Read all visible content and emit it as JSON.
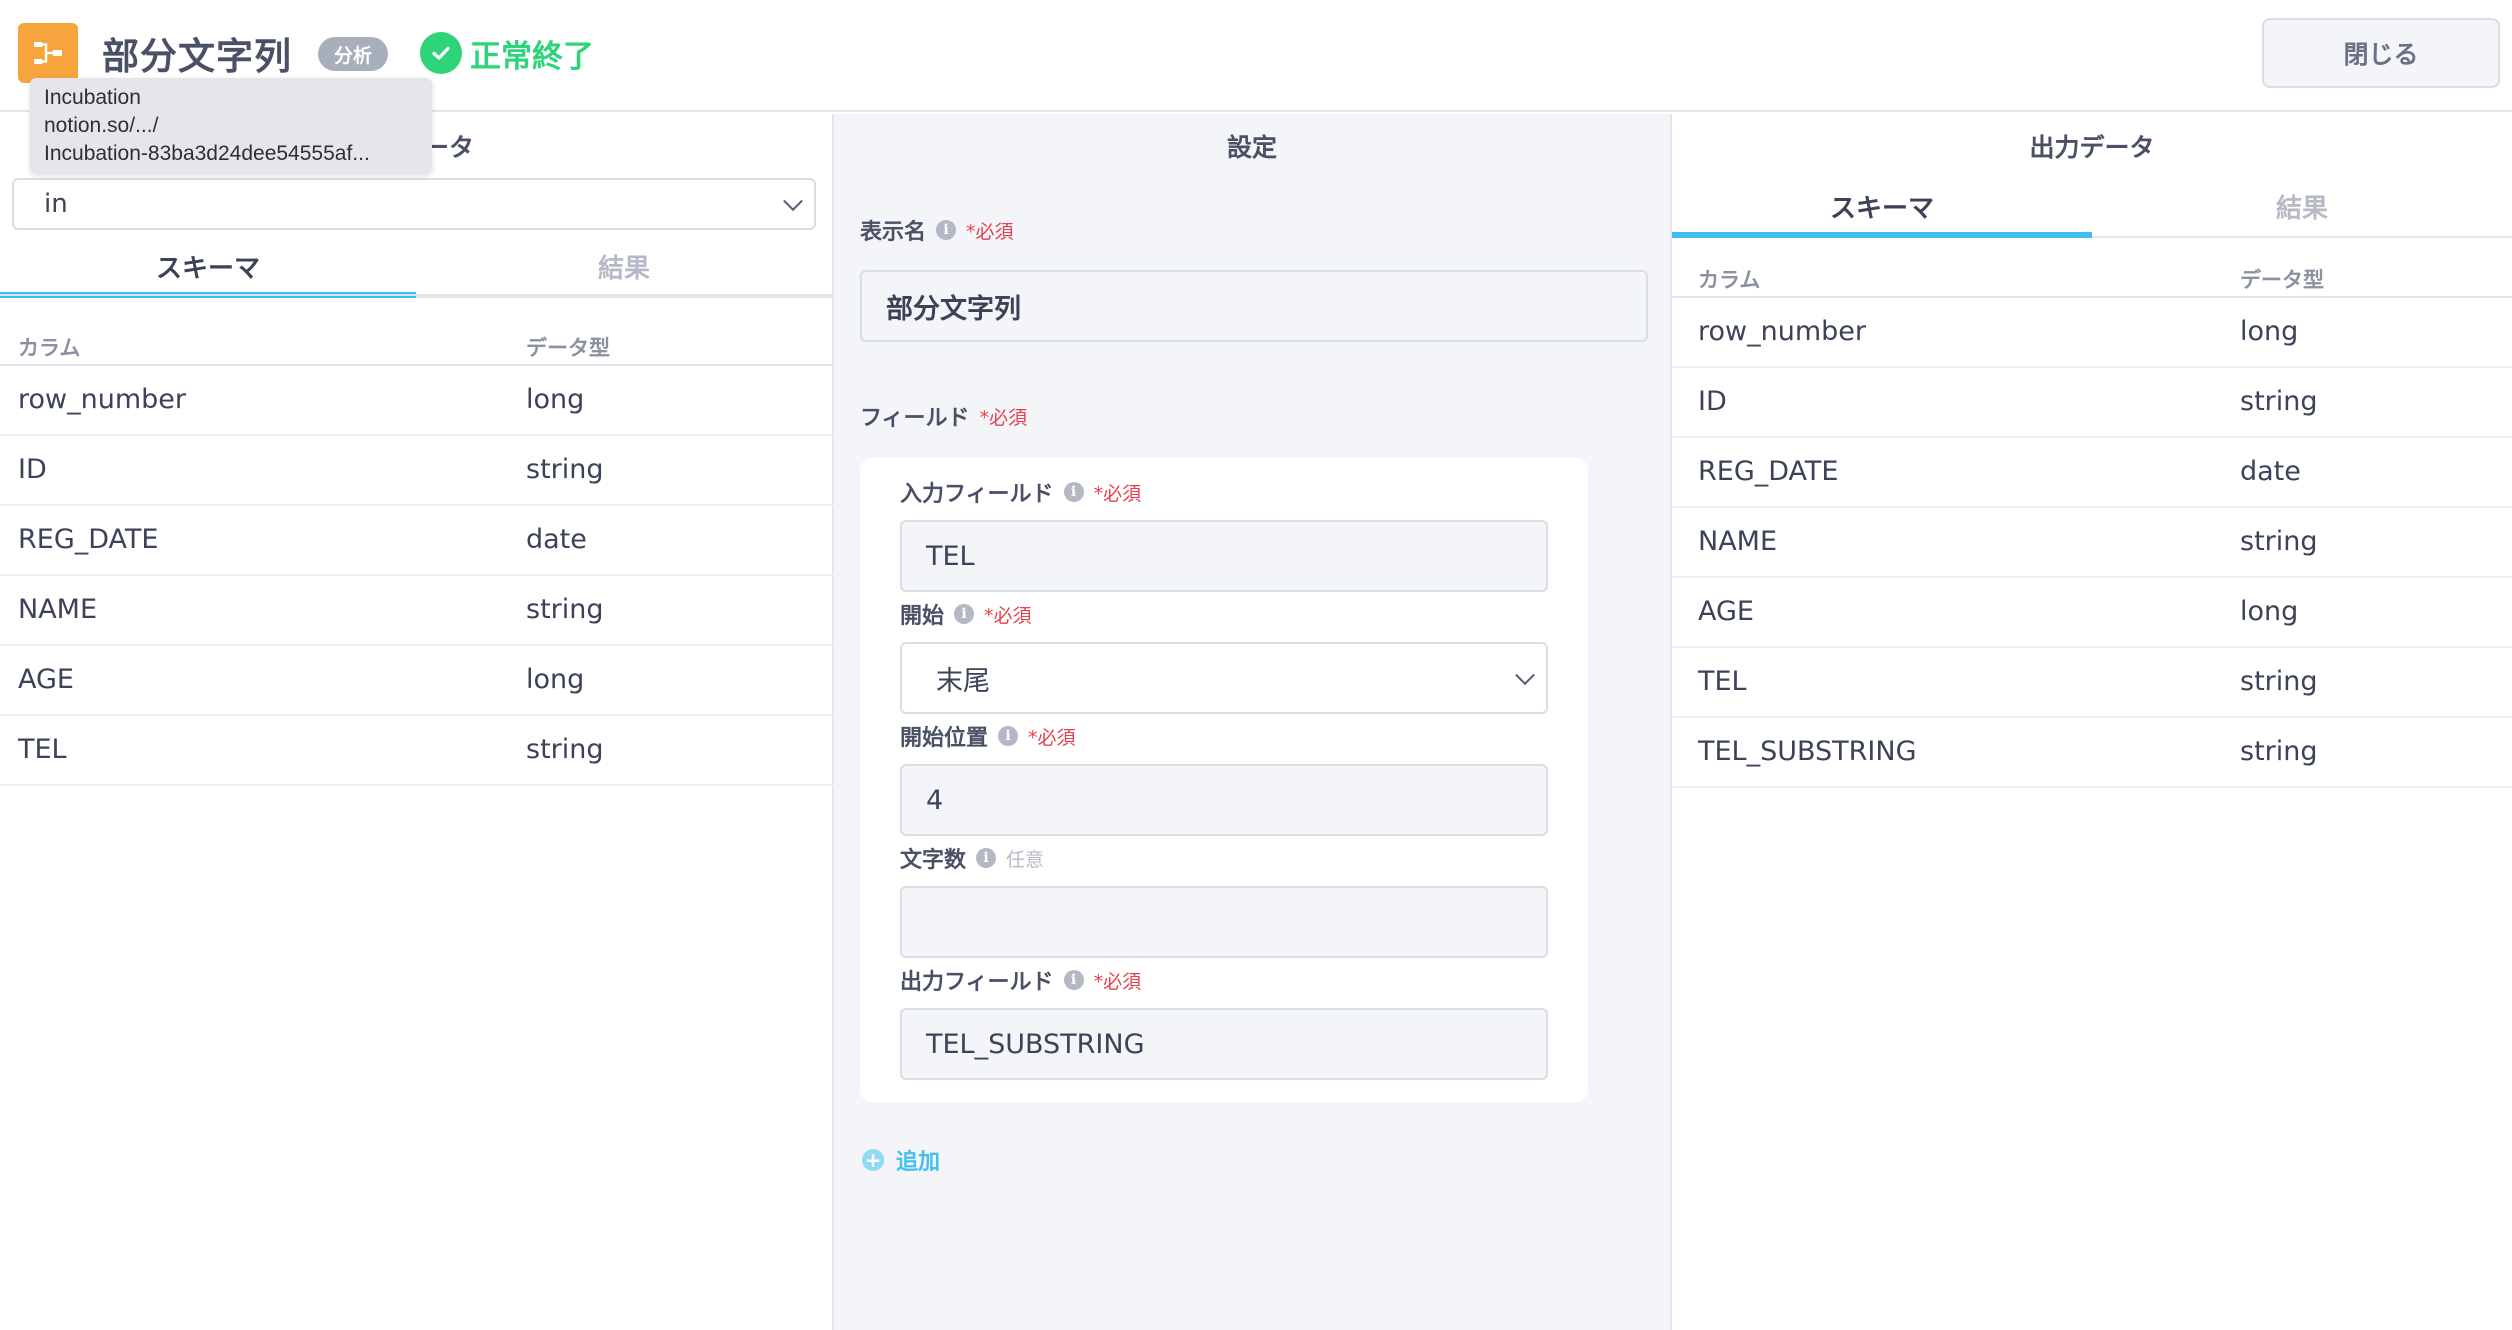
{
  "header": {
    "title": "部分文字列",
    "category": "分析",
    "status": "正常終了",
    "close_label": "閉じる"
  },
  "tooltip": {
    "lines": [
      "Incubation",
      "notion.so/.../",
      "Incubation-83ba3d24dee54555af..."
    ]
  },
  "input_panel": {
    "heading_visible": "ータ",
    "selected": "in",
    "tabs": [
      "スキーマ",
      "結果"
    ],
    "active_tab": 0,
    "columns": [
      "カラム",
      "データ型"
    ],
    "rows": [
      {
        "name": "row_number",
        "type": "long"
      },
      {
        "name": "ID",
        "type": "string"
      },
      {
        "name": "REG_DATE",
        "type": "date"
      },
      {
        "name": "NAME",
        "type": "string"
      },
      {
        "name": "AGE",
        "type": "long"
      },
      {
        "name": "TEL",
        "type": "string"
      }
    ]
  },
  "settings": {
    "heading": "設定",
    "display_name_label": "表示名",
    "display_name_value": "部分文字列",
    "required_mark": "*必須",
    "optional_mark": "任意",
    "fields_label": "フィールド",
    "input_field_label": "入力フィールド",
    "input_field_value": "TEL",
    "start_label": "開始",
    "start_value": "末尾",
    "start_pos_label": "開始位置",
    "start_pos_value": "4",
    "length_label": "文字数",
    "length_value": "",
    "output_field_label": "出力フィールド",
    "output_field_value": "TEL_SUBSTRING",
    "add_label": "追加"
  },
  "output_panel": {
    "heading": "出力データ",
    "tabs": [
      "スキーマ",
      "結果"
    ],
    "active_tab": 0,
    "columns": [
      "カラム",
      "データ型"
    ],
    "rows": [
      {
        "name": "row_number",
        "type": "long"
      },
      {
        "name": "ID",
        "type": "string"
      },
      {
        "name": "REG_DATE",
        "type": "date"
      },
      {
        "name": "NAME",
        "type": "string"
      },
      {
        "name": "AGE",
        "type": "long"
      },
      {
        "name": "TEL",
        "type": "string"
      },
      {
        "name": "TEL_SUBSTRING",
        "type": "string"
      }
    ]
  },
  "colors": {
    "accent": "#3dbdf0",
    "node_icon": "#f7a43c",
    "success": "#2ed47a",
    "required": "#e5424d"
  },
  "icons": [
    "node-flow-icon",
    "check-circle-icon",
    "info-icon",
    "chevron-down-icon",
    "plus-circle-icon"
  ]
}
